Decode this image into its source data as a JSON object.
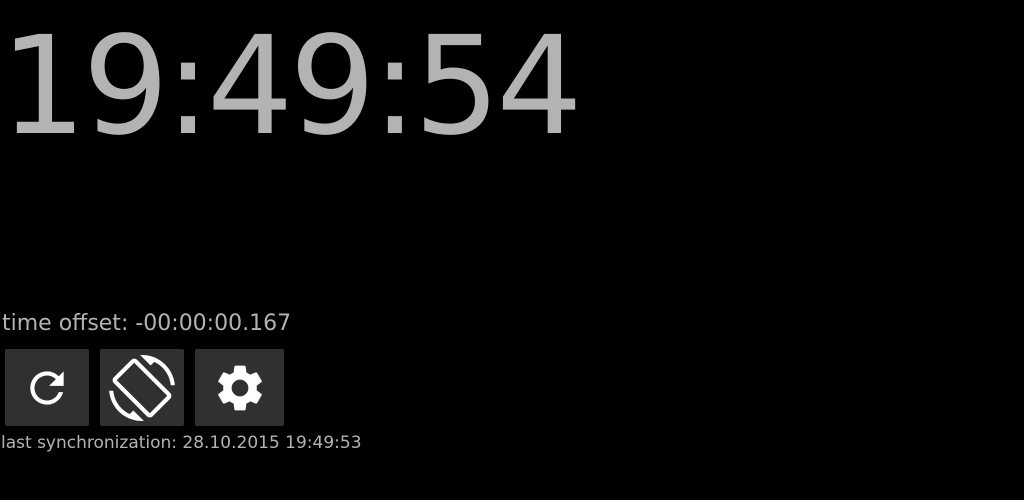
{
  "clock": {
    "time": "19:49:54"
  },
  "sync": {
    "offset_text": "time offset: -00:00:00.167",
    "last_sync_text": "last synchronization: 28.10.2015 19:49:53"
  },
  "toolbar": {
    "buttons": [
      {
        "icon": "refresh-icon"
      },
      {
        "icon": "screen-rotation-icon"
      },
      {
        "icon": "gear-icon"
      }
    ]
  },
  "colors": {
    "background": "#000000",
    "text": "#b3b3b3",
    "button_bg": "#303030",
    "icon": "#ffffff"
  }
}
